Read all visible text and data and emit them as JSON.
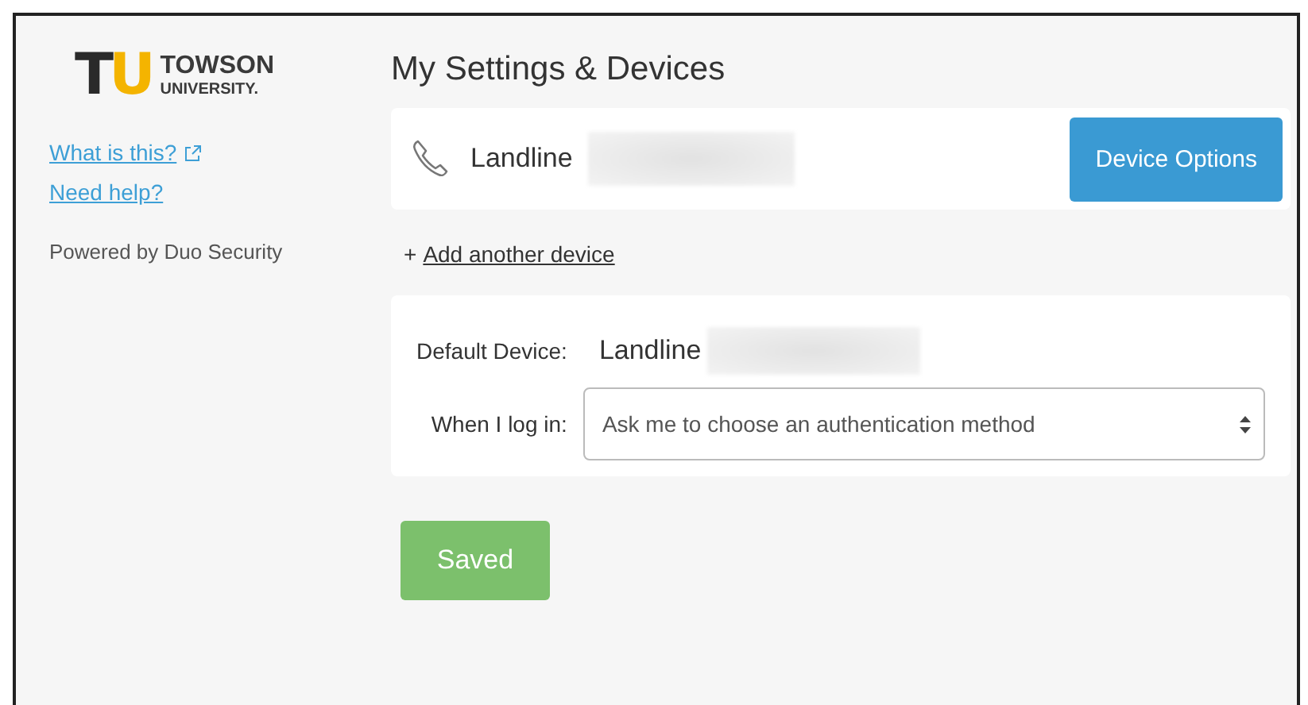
{
  "sidebar": {
    "logo": {
      "mark": "TU",
      "name": "TOWSON",
      "subname": "UNIVERSITY."
    },
    "links": [
      {
        "label": "What is this?",
        "external": true
      },
      {
        "label": "Need help?",
        "external": false
      }
    ],
    "powered_by": "Powered by Duo Security"
  },
  "title": "My Settings & Devices",
  "device": {
    "name": "Landline",
    "options_button": "Device Options"
  },
  "add_device": {
    "prefix": "+",
    "label": "Add another device"
  },
  "settings": {
    "default_label": "Default Device:",
    "default_value": "Landline",
    "login_label": "When I log in:",
    "login_value": "Ask me to choose an authentication method"
  },
  "save_button": "Saved"
}
